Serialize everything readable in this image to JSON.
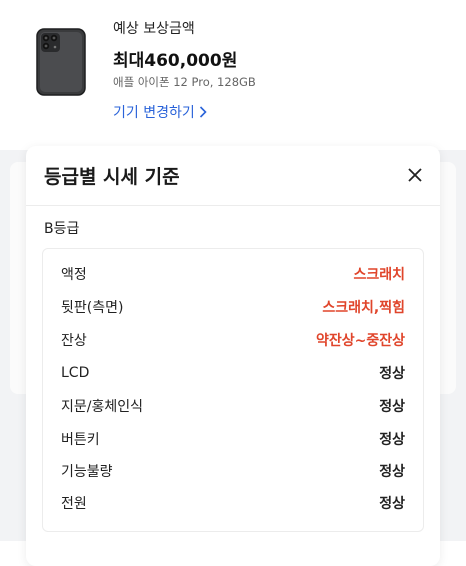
{
  "summary": {
    "estimate_label": "예상 보상금액",
    "estimate_amount": "최대460,000원",
    "device_model": "애플 아이폰 12 Pro, 128GB",
    "change_device_label": "기기 변경하기"
  },
  "modal": {
    "title": "등급별 시세 기준",
    "grade": "B등급",
    "rows": [
      {
        "key": "액정",
        "value": "스크래치",
        "status": "bad"
      },
      {
        "key": "뒷판(측면)",
        "value": "스크래치,찍힘",
        "status": "bad"
      },
      {
        "key": "잔상",
        "value": "약잔상~중잔상",
        "status": "bad"
      },
      {
        "key": "LCD",
        "value": "정상",
        "status": "ok"
      },
      {
        "key": "지문/홍체인식",
        "value": "정상",
        "status": "ok"
      },
      {
        "key": "버튼키",
        "value": "정상",
        "status": "ok"
      },
      {
        "key": "기능불량",
        "value": "정상",
        "status": "ok"
      },
      {
        "key": "전원",
        "value": "정상",
        "status": "ok"
      }
    ]
  },
  "colors": {
    "accent_link": "#2a63d9",
    "defect_text": "#e0452b"
  },
  "icons": {
    "close": "close-icon",
    "chevron": "chevron-right-icon",
    "phone": "phone-thumbnail"
  }
}
